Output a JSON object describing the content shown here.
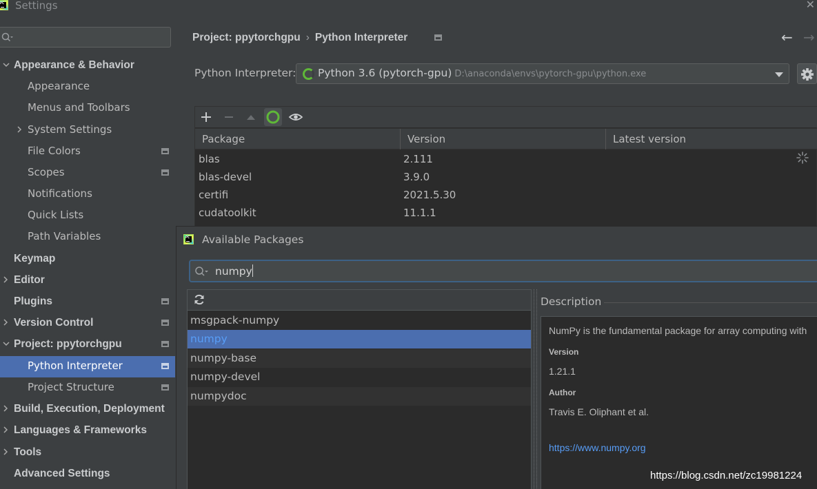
{
  "window": {
    "title": "Settings"
  },
  "sidebar": {
    "search_placeholder": "",
    "items": [
      {
        "label": "Appearance & Behavior",
        "expanded": true
      },
      {
        "label": "Appearance"
      },
      {
        "label": "Menus and Toolbars"
      },
      {
        "label": "System Settings"
      },
      {
        "label": "File Colors"
      },
      {
        "label": "Scopes"
      },
      {
        "label": "Notifications"
      },
      {
        "label": "Quick Lists"
      },
      {
        "label": "Path Variables"
      },
      {
        "label": "Keymap"
      },
      {
        "label": "Editor"
      },
      {
        "label": "Plugins"
      },
      {
        "label": "Version Control"
      },
      {
        "label": "Project: ppytorchgpu",
        "expanded": true
      },
      {
        "label": "Python Interpreter",
        "selected": true
      },
      {
        "label": "Project Structure"
      },
      {
        "label": "Build, Execution, Deployment"
      },
      {
        "label": "Languages & Frameworks"
      },
      {
        "label": "Tools"
      },
      {
        "label": "Advanced Settings"
      }
    ]
  },
  "breadcrumb": {
    "project": "Project: ppytorchgpu",
    "separator": "›",
    "page": "Python Interpreter"
  },
  "interpreter": {
    "label": "Python Interpreter:",
    "name": "Python 3.6 (pytorch-gpu)",
    "path": "D:\\anaconda\\envs\\pytorch-gpu\\python.exe"
  },
  "packages_table": {
    "columns": [
      "Package",
      "Version",
      "Latest version"
    ],
    "rows": [
      {
        "package": "blas",
        "version": "2.111",
        "latest": ""
      },
      {
        "package": "blas-devel",
        "version": "3.9.0",
        "latest": ""
      },
      {
        "package": "certifi",
        "version": "2021.5.30",
        "latest": ""
      },
      {
        "package": "cudatoolkit",
        "version": "11.1.1",
        "latest": ""
      }
    ]
  },
  "available_packages": {
    "title": "Available Packages",
    "search_value": "numpy",
    "list": [
      {
        "name": "msgpack-numpy"
      },
      {
        "name": "numpy",
        "selected": true
      },
      {
        "name": "numpy-base"
      },
      {
        "name": "numpy-devel"
      },
      {
        "name": "numpydoc"
      }
    ],
    "description": {
      "label": "Description",
      "summary": "NumPy is the fundamental package for array computing with",
      "version_label": "Version",
      "version": "1.21.1",
      "author_label": "Author",
      "author": "Travis E. Oliphant et al.",
      "url": "https://www.numpy.org"
    }
  },
  "watermark": "https://blog.csdn.net/zc19981224",
  "colors": {
    "selection": "#4b6eaf",
    "link": "#589df6",
    "panel": "#3c3f41",
    "background": "#2b2b2b",
    "spinner": "#5fb838"
  }
}
